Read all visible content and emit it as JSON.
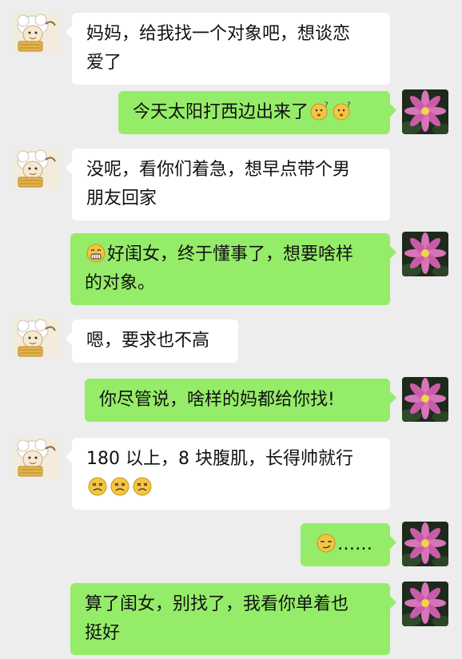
{
  "messages": [
    {
      "side": "left",
      "lines": [
        "妈妈，给我找一个对象吧，想谈恋",
        "爱了"
      ]
    },
    {
      "side": "right",
      "text": "今天太阳打西边出来了",
      "emojis": [
        "confused-face-icon",
        "confused-face-icon"
      ]
    },
    {
      "side": "left",
      "lines": [
        "没呢，看你们着急，想早点带个男",
        "朋友回家"
      ]
    },
    {
      "side": "right",
      "lead_emoji": "grinning-face-icon",
      "lines": [
        "好闺女，终于懂事了，想要啥样",
        "的对象。"
      ]
    },
    {
      "side": "left",
      "text": "嗯，要求也不高"
    },
    {
      "side": "right",
      "text": "你尽管说，啥样的妈都给你找!"
    },
    {
      "side": "left",
      "lines": [
        "180 以上，8 块腹肌，长得帅就行"
      ],
      "emojis": [
        "dizzy-face-icon",
        "dizzy-face-icon",
        "dizzy-face-icon"
      ]
    },
    {
      "side": "right",
      "lead_emoji": "smirk-face-icon",
      "text": "……"
    },
    {
      "side": "right",
      "lines": [
        "算了闺女，别找了，我看你单着也",
        "挺好"
      ]
    }
  ],
  "colors": {
    "background": "#ededed",
    "left_bubble": "#ffffff",
    "right_bubble": "#95ec69"
  }
}
